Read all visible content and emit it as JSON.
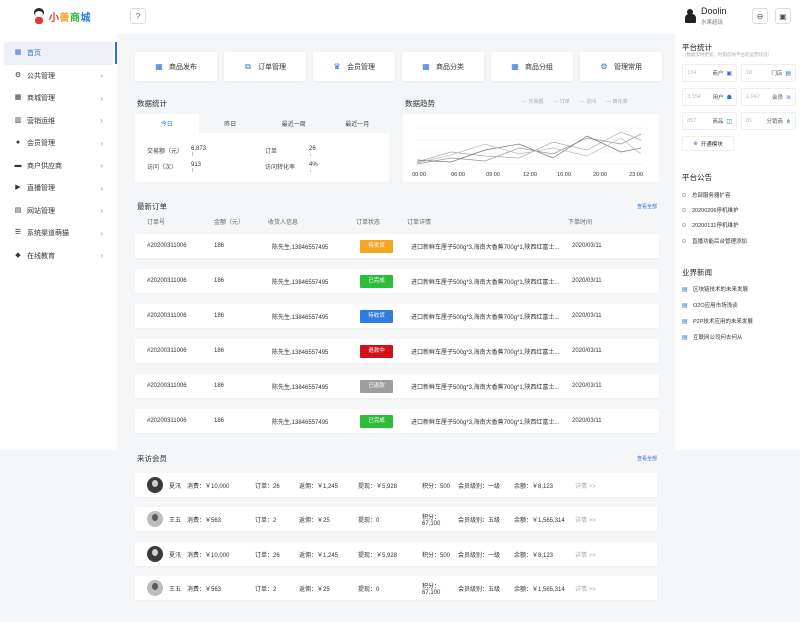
{
  "app": {
    "logo_chars": [
      "小",
      "兽",
      "商",
      "城"
    ]
  },
  "topbar": {
    "help_icon": "question-icon",
    "user_name": "Doolin",
    "user_role": "水果超级",
    "btn1_icon": "minus-circle-icon",
    "btn2_icon": "window-icon"
  },
  "sidebar": {
    "items": [
      {
        "label": "首页",
        "icon": "home-icon",
        "active": true
      },
      {
        "label": "公共管理",
        "icon": "settings-icon"
      },
      {
        "label": "商城管理",
        "icon": "grid-icon"
      },
      {
        "label": "营销运维",
        "icon": "chart-icon"
      },
      {
        "label": "会员管理",
        "icon": "user-icon"
      },
      {
        "label": "商户供应商",
        "icon": "truck-icon"
      },
      {
        "label": "直播管理",
        "icon": "video-icon"
      },
      {
        "label": "网站管理",
        "icon": "folder-icon"
      },
      {
        "label": "系统渠道萌猫",
        "icon": "list-icon"
      },
      {
        "label": "在线教育",
        "icon": "book-icon"
      }
    ]
  },
  "quick_actions": [
    {
      "label": "商品发布",
      "icon": "grid-icon"
    },
    {
      "label": "订单管理",
      "icon": "external-icon"
    },
    {
      "label": "会员管理",
      "icon": "crown-icon"
    },
    {
      "label": "商品分类",
      "icon": "grid-icon"
    },
    {
      "label": "商品分组",
      "icon": "grid-icon"
    },
    {
      "label": "管理常用",
      "icon": "gear-icon"
    }
  ],
  "stats": {
    "title": "数据统计",
    "tabs": [
      "今日",
      "昨日",
      "最近一周",
      "最近一月"
    ],
    "items": [
      {
        "label": "交易额（元）",
        "value": "6,873",
        "trend": "up"
      },
      {
        "label": "订单",
        "value": "26",
        "trend": "down"
      },
      {
        "label": "访问（次）",
        "value": "913",
        "trend": "up"
      },
      {
        "label": "访问转化率",
        "value": "4%",
        "trend": "down"
      }
    ]
  },
  "trend": {
    "title": "数据趋势",
    "legend": [
      "交易额",
      "订单",
      "访问",
      "转化率"
    ]
  },
  "orders": {
    "title": "最新订单",
    "view_all": "查看全部",
    "headers": [
      "订单号",
      "金额（元）",
      "收货人信息",
      "订单状态",
      "订单详情",
      "下单时间"
    ],
    "rows": [
      {
        "id": "#20200311006",
        "amount": "186",
        "contact": "陈先生,13846557495",
        "status": "待发货",
        "status_color": "#f5a623",
        "detail": "进口新鲜车厘子500g*3,海南大香蕉700g*1,陕西红富士...",
        "time": "2020/03/11"
      },
      {
        "id": "#20200311006",
        "amount": "186",
        "contact": "陈先生,13846557495",
        "status": "已完成",
        "status_color": "#2ebd39",
        "detail": "进口新鲜车厘子500g*3,海南大香蕉700g*1,陕西红富士...",
        "time": "2020/03/11"
      },
      {
        "id": "#20200311006",
        "amount": "186",
        "contact": "陈先生,13846557495",
        "status": "待收货",
        "status_color": "#2f7de1",
        "detail": "进口新鲜车厘子500g*3,海南大香蕉700g*1,陕西红富士...",
        "time": "2020/03/11"
      },
      {
        "id": "#20200311006",
        "amount": "186",
        "contact": "陈先生,13846557495",
        "status": "退款中",
        "status_color": "#d0121b",
        "detail": "进口新鲜车厘子500g*3,海南大香蕉700g*1,陕西红富士...",
        "time": "2020/03/11"
      },
      {
        "id": "#20200311006",
        "amount": "186",
        "contact": "陈先生,13846557495",
        "status": "已退款",
        "status_color": "#9e9e9e",
        "detail": "进口新鲜车厘子500g*3,海南大香蕉700g*1,陕西红富士...",
        "time": "2020/03/11"
      },
      {
        "id": "#20200311006",
        "amount": "186",
        "contact": "陈先生,13846557495",
        "status": "已完成",
        "status_color": "#2ebd39",
        "detail": "进口新鲜车厘子500g*3,海南大香蕉700g*1,陕西红富士...",
        "time": "2020/03/11"
      }
    ]
  },
  "members": {
    "title": "来访会员",
    "view_all": "查看全部",
    "rows": [
      {
        "name": "夏汛",
        "avatar": "dark",
        "spend": "消费：￥10,000",
        "orders": "订单：26",
        "rebate": "返佣：￥1,245",
        "withdraw": "提现：￥5,928",
        "points": "积分：500",
        "level": "会员级别：一级",
        "balance": "余额：￥8,123",
        "detail": "详情 >>"
      },
      {
        "name": "王五",
        "avatar": "light",
        "spend": "消费：￥563",
        "orders": "订单：2",
        "rebate": "返佣：￥25",
        "withdraw": "提现：0",
        "points": "积分：67,100",
        "level": "会员级别：五级",
        "balance": "余额：￥1,565,314",
        "detail": "详情 >>"
      },
      {
        "name": "夏汛",
        "avatar": "dark",
        "spend": "消费：￥10,000",
        "orders": "订单：26",
        "rebate": "返佣：￥1,245",
        "withdraw": "提现：￥5,928",
        "points": "积分：500",
        "level": "会员级别：一级",
        "balance": "余额：￥8,123",
        "detail": "详情 >>"
      },
      {
        "name": "王五",
        "avatar": "light",
        "spend": "消费：￥563",
        "orders": "订单：2",
        "rebate": "返佣：￥25",
        "withdraw": "提现：0",
        "points": "积分：67,100",
        "level": "会员级别：五级",
        "balance": "余额：￥1,565,314",
        "detail": "详情 >>"
      }
    ]
  },
  "platform": {
    "title": "平台统计",
    "subtitle": "（数据实时更新，时刻反映平台的运营状况）",
    "items": [
      {
        "value": "134",
        "label": "商户",
        "icon": "shop-icon"
      },
      {
        "value": "18",
        "label": "门店",
        "icon": "store-icon"
      },
      {
        "value": "3,154",
        "label": "用户",
        "icon": "users-icon"
      },
      {
        "value": "1,942",
        "label": "会员",
        "icon": "wifi-icon"
      },
      {
        "value": "857",
        "label": "商品",
        "icon": "box-icon"
      },
      {
        "value": "81",
        "label": "分销商",
        "icon": "share-icon"
      }
    ],
    "open_label": "开通模块"
  },
  "announcements": {
    "title": "平台公告",
    "items": [
      "总部服务器扩容",
      "20200206停机维护",
      "20200131停机维护",
      "直播功能后台管理添加"
    ]
  },
  "news": {
    "title": "业界新闻",
    "items": [
      "区块链技术的未来发展",
      "O2O应用市场浅谈",
      "P2P技术应用的未来发展",
      "互联网公司何去何从"
    ]
  }
}
